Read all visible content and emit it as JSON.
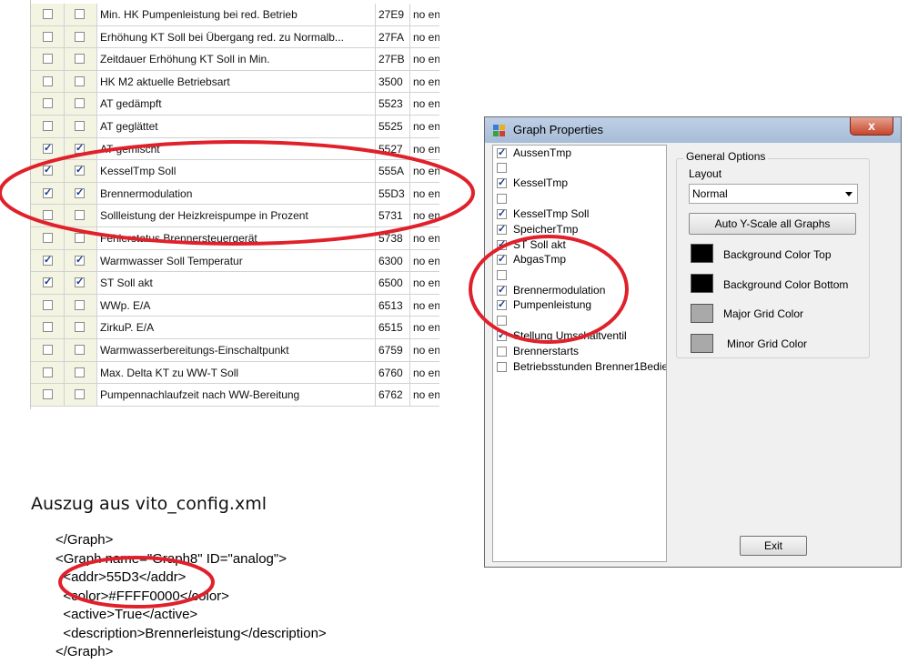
{
  "table": {
    "rows": [
      {
        "c1": false,
        "c2": false,
        "name": "Min. HK Pumpenleistung bei red. Betrieb",
        "addr": "27E9",
        "value": "no entry"
      },
      {
        "c1": false,
        "c2": false,
        "name": "Erhöhung KT Soll bei Übergang red. zu Normalb...",
        "addr": "27FA",
        "value": "no entry"
      },
      {
        "c1": false,
        "c2": false,
        "name": "Zeitdauer Erhöhung KT Soll in Min.",
        "addr": "27FB",
        "value": "no entry"
      },
      {
        "c1": false,
        "c2": false,
        "name": "HK M2 aktuelle Betriebsart",
        "addr": "3500",
        "value": "no entry"
      },
      {
        "c1": false,
        "c2": false,
        "name": "AT gedämpft",
        "addr": "5523",
        "value": "no entry"
      },
      {
        "c1": false,
        "c2": false,
        "name": "AT geglättet",
        "addr": "5525",
        "value": "no entry"
      },
      {
        "c1": true,
        "c2": true,
        "name": "AT gemischt",
        "addr": "5527",
        "value": "no entry"
      },
      {
        "c1": true,
        "c2": true,
        "name": "KesselTmp Soll",
        "addr": "555A",
        "value": "no entry"
      },
      {
        "c1": true,
        "c2": true,
        "name": "Brennermodulation",
        "addr": "55D3",
        "value": "no entry"
      },
      {
        "c1": false,
        "c2": false,
        "name": "Sollleistung der Heizkreispumpe in Prozent",
        "addr": "5731",
        "value": "no entry"
      },
      {
        "c1": false,
        "c2": false,
        "name": "Fehlerstatus Brennersteuergerät",
        "addr": "5738",
        "value": "no entry"
      },
      {
        "c1": true,
        "c2": true,
        "name": "Warmwasser Soll Temperatur",
        "addr": "6300",
        "value": "no entry"
      },
      {
        "c1": true,
        "c2": true,
        "name": "ST Soll akt",
        "addr": "6500",
        "value": "no entry"
      },
      {
        "c1": false,
        "c2": false,
        "name": "WWp.  E/A",
        "addr": "6513",
        "value": "no entry"
      },
      {
        "c1": false,
        "c2": false,
        "name": "ZirkuP.  E/A",
        "addr": "6515",
        "value": "no entry"
      },
      {
        "c1": false,
        "c2": false,
        "name": "Warmwasserbereitungs-Einschaltpunkt",
        "addr": "6759",
        "value": "no entry"
      },
      {
        "c1": false,
        "c2": false,
        "name": "Max. Delta KT zu WW-T Soll",
        "addr": "6760",
        "value": "no entry"
      },
      {
        "c1": false,
        "c2": false,
        "name": "Pumpennachlaufzeit nach WW-Bereitung",
        "addr": "6762",
        "value": "no entry"
      }
    ]
  },
  "dialog": {
    "title": "Graph Properties",
    "close_label": "x",
    "graphs": [
      {
        "label": "AussenTmp",
        "checked": true
      },
      {
        "label": "",
        "checked": false
      },
      {
        "label": "KesselTmp",
        "checked": true
      },
      {
        "label": "",
        "checked": false
      },
      {
        "label": "KesselTmp Soll",
        "checked": true
      },
      {
        "label": "SpeicherTmp",
        "checked": true
      },
      {
        "label": "ST Soll akt",
        "checked": true
      },
      {
        "label": "AbgasTmp",
        "checked": true
      },
      {
        "label": "",
        "checked": false
      },
      {
        "label": "Brennermodulation",
        "checked": true
      },
      {
        "label": "Pumpenleistung",
        "checked": true
      },
      {
        "label": "",
        "checked": false
      },
      {
        "label": "Stellung Umschaltventil",
        "checked": true
      },
      {
        "label": "Brennerstarts",
        "checked": false
      },
      {
        "label": "Betriebsstunden Brenner1Bedie",
        "checked": false
      }
    ],
    "general_options": "General Options",
    "layout_label": "Layout",
    "layout_value": "Normal",
    "auto_scale_label": "Auto Y-Scale all Graphs",
    "colors": [
      {
        "label": "Background Color Top",
        "color": "#000000"
      },
      {
        "label": "Background Color Bottom",
        "color": "#000000"
      },
      {
        "label": "Major Grid Color",
        "color": "#a9a9a9"
      },
      {
        "label": "Minor Grid Color",
        "color": "#a9a9a9"
      }
    ],
    "exit_label": "Exit"
  },
  "xml": {
    "heading": "Auszug aus vito_config.xml",
    "lines": [
      "</Graph>",
      "<Graph name=\"Graph8\" ID=\"analog\">",
      "  <addr>55D3</addr>",
      "  <color>#FFFF0000</color>",
      "  <active>True</active>",
      "  <description>Brennerleistung</description>",
      "</Graph>"
    ]
  },
  "annotation_color": "#e0202a"
}
